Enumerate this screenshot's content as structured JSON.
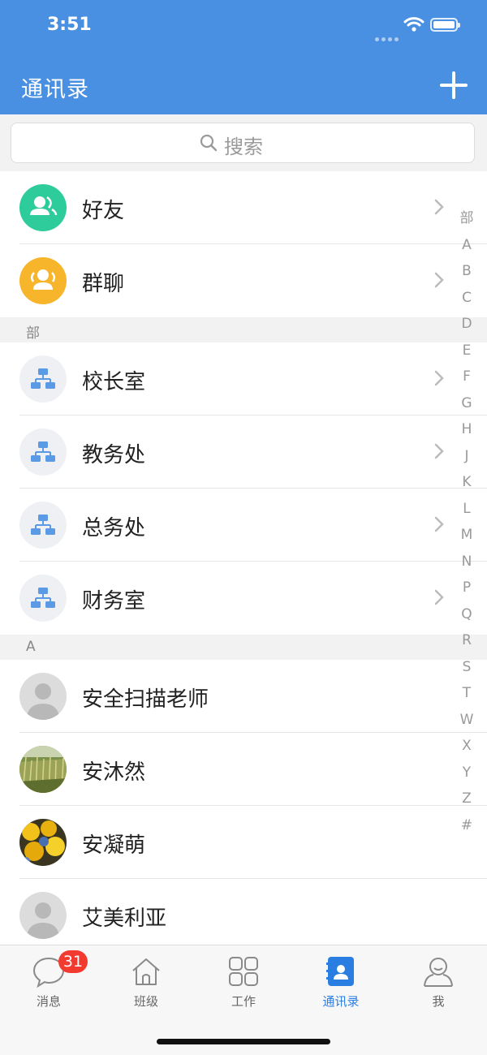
{
  "status": {
    "time": "3:51"
  },
  "header": {
    "title": "通讯录"
  },
  "search": {
    "placeholder": "搜索"
  },
  "top_items": [
    {
      "label": "好友",
      "icon": "friends-icon",
      "color": "#2ecc9a"
    },
    {
      "label": "群聊",
      "icon": "group-chat-icon",
      "color": "#f7b52c"
    }
  ],
  "dept_section": {
    "header": "部"
  },
  "departments": [
    {
      "label": "校长室",
      "icon": "org-chart-icon"
    },
    {
      "label": "教务处",
      "icon": "org-chart-icon"
    },
    {
      "label": "总务处",
      "icon": "org-chart-icon"
    },
    {
      "label": "财务室",
      "icon": "org-chart-icon"
    }
  ],
  "contact_section": {
    "header": "A"
  },
  "contacts": [
    {
      "name": "安全扫描老师",
      "avatar": "default-avatar"
    },
    {
      "name": "安沐然",
      "avatar": "grass-photo"
    },
    {
      "name": "安凝萌",
      "avatar": "yellow-leaves-photo"
    },
    {
      "name": "艾美利亚",
      "avatar": "default-avatar"
    }
  ],
  "index_bar": [
    "部",
    "A",
    "B",
    "C",
    "D",
    "E",
    "F",
    "G",
    "H",
    "J",
    "K",
    "L",
    "M",
    "N",
    "P",
    "Q",
    "R",
    "S",
    "T",
    "W",
    "X",
    "Y",
    "Z",
    "#"
  ],
  "tabs": [
    {
      "label": "消息",
      "icon": "chat-bubble-icon",
      "badge": "31"
    },
    {
      "label": "班级",
      "icon": "home-icon"
    },
    {
      "label": "工作",
      "icon": "grid-icon"
    },
    {
      "label": "通讯录",
      "icon": "contacts-book-icon",
      "active": true
    },
    {
      "label": "我",
      "icon": "person-icon"
    }
  ],
  "colors": {
    "header_bg": "#4a90e2",
    "active_tab": "#2a7de1",
    "badge": "#f23b30"
  }
}
